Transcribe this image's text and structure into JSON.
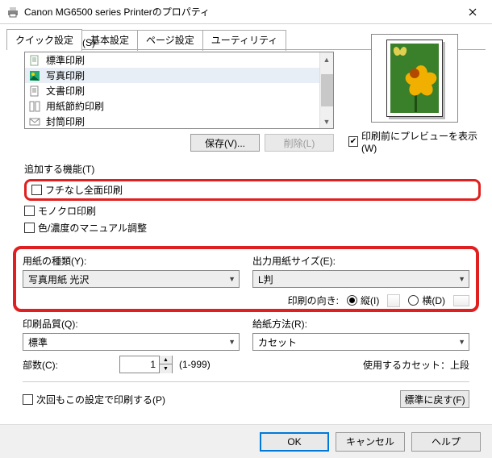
{
  "window": {
    "title": "Canon MG6500 series Printerのプロパティ"
  },
  "tabs": {
    "quick": "クイック設定",
    "basic": "基本設定",
    "page": "ページ設定",
    "utility": "ユーティリティ"
  },
  "freq": {
    "label": "よく使う設定(S)",
    "items": [
      "標準印刷",
      "写真印刷",
      "文書印刷",
      "用紙節約印刷",
      "封筒印刷"
    ],
    "save_btn": "保存(V)...",
    "delete_btn": "削除(L)"
  },
  "preview_chk": "印刷前にプレビューを表示(W)",
  "addfeat": {
    "label": "追加する機能(T)",
    "borderless": "フチなし全面印刷",
    "mono": "モノクロ印刷",
    "colormanual": "色/濃度のマニュアル調整"
  },
  "paper": {
    "type_label": "用紙の種類(Y):",
    "type_value": "写真用紙 光沢",
    "size_label": "出力用紙サイズ(E):",
    "size_value": "L判",
    "orient_label": "印刷の向き:",
    "portrait": "縦(I)",
    "landscape": "横(D)"
  },
  "quality": {
    "label": "印刷品質(Q):",
    "value": "標準"
  },
  "source": {
    "label": "給紙方法(R):",
    "value": "カセット",
    "note": "使用するカセット：上段"
  },
  "copies": {
    "label": "部数(C):",
    "value": "1",
    "range": "(1-999)"
  },
  "keep": "次回もこの設定で印刷する(P)",
  "defaults_btn": "標準に戻す(F)",
  "dlg": {
    "ok": "OK",
    "cancel": "キャンセル",
    "help": "ヘルプ"
  }
}
